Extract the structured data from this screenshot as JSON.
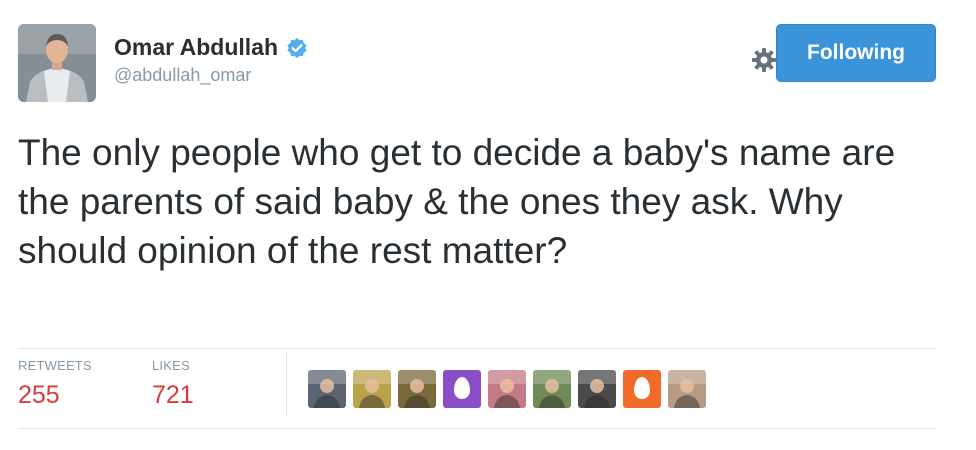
{
  "tweet": {
    "author": {
      "display_name": "Omar Abdullah",
      "handle": "@abdullah_omar",
      "verified": true
    },
    "follow_button_label": "Following",
    "text": "The only people who get to decide a baby's name are the parents of said baby & the ones they ask. Why should opinion of the rest matter?",
    "stats": {
      "retweets_label": "RETWEETS",
      "retweets_value": "255",
      "likes_label": "LIKES",
      "likes_value": "721"
    },
    "likers": [
      {
        "type": "photo",
        "color": "#5b6470"
      },
      {
        "type": "photo",
        "color": "#b9a24a"
      },
      {
        "type": "photo",
        "color": "#7a6a3a"
      },
      {
        "type": "egg",
        "color": "#8a4fc7"
      },
      {
        "type": "photo",
        "color": "#c47a86"
      },
      {
        "type": "photo",
        "color": "#6f8a55"
      },
      {
        "type": "photo",
        "color": "#4a4a4a"
      },
      {
        "type": "egg",
        "color": "#f26b2a"
      },
      {
        "type": "photo",
        "color": "#b79a84"
      }
    ]
  },
  "colors": {
    "accent_blue": "#3b94d9",
    "verified_blue": "#55acee",
    "stat_value_red": "#d73b3b",
    "muted_gray": "#8899a6"
  },
  "icons": [
    "verified-badge-icon",
    "gear-icon"
  ]
}
